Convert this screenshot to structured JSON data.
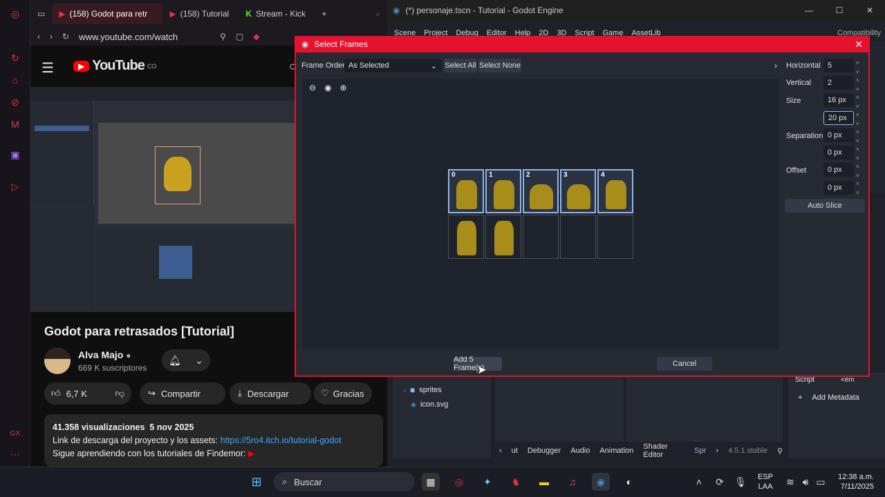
{
  "browser": {
    "tabs": [
      "(158) Godot para retr",
      "(158) Tutorial",
      "Stream - Kick"
    ],
    "url": "www.youtube.com/watch"
  },
  "youtube": {
    "logo": "YouTube",
    "country_code": "CO",
    "video_title": "Godot para retrasados [Tutorial]",
    "channel": "Alva Majo",
    "subscribers": "669 K suscriptores",
    "likes": "6,7 K",
    "share": "Compartir",
    "download": "Descargar",
    "thanks": "Gracias",
    "views": "41.358 visualizaciones",
    "date": "5 nov 2025",
    "desc1_prefix": "Link de descarga del proyecto y los assets:",
    "desc1_link": "https://5ro4.itch.io/tutorial-godot",
    "desc2": "Sigue aprendiendo con los tutoriales de Findemor:"
  },
  "godot": {
    "title": "(*) personaje.tscn - Tutorial - Godot Engine",
    "menu": [
      "Scene",
      "Project",
      "Debug",
      "Editor",
      "Help",
      "2D",
      "3D",
      "Script",
      "Game",
      "AssetLib"
    ],
    "compat": "Compatibility",
    "filesystem": [
      "sprites",
      "icon.svg"
    ],
    "bottom_tabs": [
      "ut",
      "Debugger",
      "Audio",
      "Animation",
      "Shader Editor",
      "Spr"
    ],
    "version": "4.5.1.stable",
    "inspector_script": "Script",
    "inspector_empty": "<em",
    "add_metadata": "Add Metadata"
  },
  "dialog": {
    "title": "Select Frames",
    "frame_order_label": "Frame Order",
    "frame_order_value": "As Selected",
    "select_all": "Select All",
    "select_none": "Select None",
    "horizontal_label": "Horizontal",
    "horizontal_value": "5",
    "vertical_label": "Vertical",
    "vertical_value": "2",
    "size_label": "Size",
    "size_x": "16 px",
    "size_y": "20 px",
    "separation_label": "Separation",
    "sep_x": "0 px",
    "sep_y": "0 px",
    "offset_label": "Offset",
    "off_x": "0 px",
    "off_y": "0 px",
    "auto_slice": "Auto Slice",
    "add_frames": "Add 5 Frame(s)",
    "cancel": "Cancel",
    "frames_row1": [
      "0",
      "1",
      "2",
      "3",
      "4"
    ]
  },
  "taskbar": {
    "search": "Buscar",
    "lang1": "ESP",
    "lang2": "LAA",
    "time": "12:38 a.m.",
    "date": "7/11/2025"
  },
  "colors": {
    "accent": "#e5122e",
    "godot_bg": "#262a33",
    "selected": "#8fb7ee"
  }
}
